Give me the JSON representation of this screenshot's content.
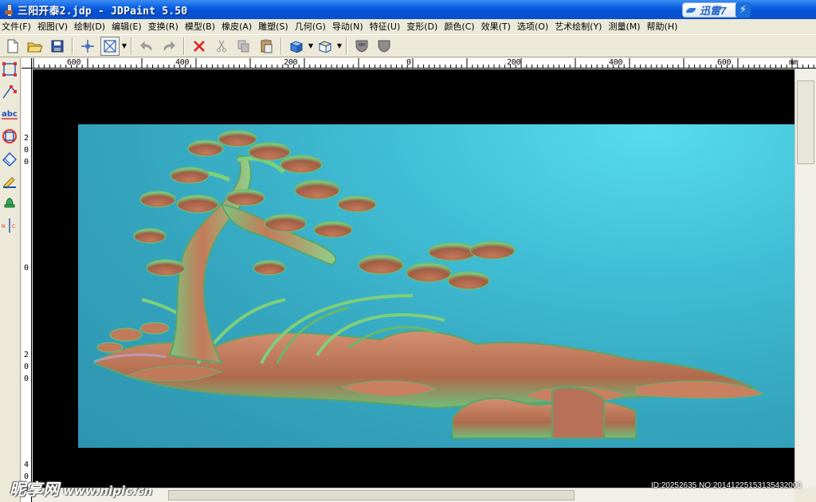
{
  "window": {
    "title": "三阳开泰2.jdp - JDPaint 5.50",
    "xunlei_label": "迅雷7",
    "xunlei_badge": "⚡"
  },
  "menu": [
    "文件(F)",
    "视图(V)",
    "绘制(D)",
    "编辑(E)",
    "变换(R)",
    "模型(B)",
    "橡皮(A)",
    "雕塑(S)",
    "几何(G)",
    "导动(N)",
    "特征(U)",
    "变形(D)",
    "颜色(C)",
    "效果(T)",
    "选项(O)",
    "艺术绘制(Y)",
    "测量(M)",
    "帮助(H)"
  ],
  "toolbar_icons": [
    "new-file-icon",
    "open-folder-icon",
    "save-icon",
    "crosshair-icon",
    "box-select-icon",
    "undo-icon",
    "redo-icon",
    "delete-icon",
    "cut-icon",
    "copy-icon",
    "paste-icon",
    "cube-view-icon",
    "box-view-icon",
    "shield-front-icon",
    "shield-back-icon"
  ],
  "left_tools": [
    "select-node-icon",
    "pen-node-icon",
    "text-abc-icon",
    "rect-circle-icon",
    "eraser-icon",
    "brush-icon",
    "bell-marker-icon",
    "nc-measure-icon"
  ],
  "h_ruler_labels": [
    "600",
    "400",
    "200",
    "0",
    "200",
    "400",
    "600",
    "mm"
  ],
  "v_ruler_labels": [
    "200",
    "0",
    "200",
    "400"
  ],
  "watermark": {
    "cn": "昵享网",
    "url": "www.nipic.cn"
  },
  "image_id": "ID:20252635 NO:20141225153135432000",
  "colors": {
    "title_bar": "#0a5fe0",
    "chrome": "#ece9d8",
    "relief_bg": "#3fbcd3",
    "relief_bark": "#c47a5a",
    "relief_leaf": "#7fcf7a"
  }
}
